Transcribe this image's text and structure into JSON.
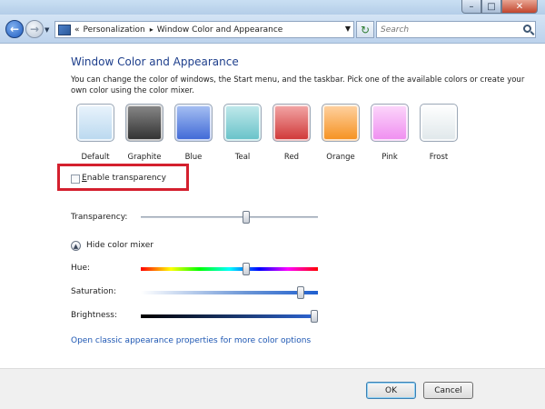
{
  "window": {
    "controls": {
      "minimize": "–",
      "maximize": "□",
      "close": "✕"
    }
  },
  "nav": {
    "back_glyph": "←",
    "forward_glyph": "→",
    "breadcrumb": [
      "«",
      "Personalization",
      "Window Color and Appearance"
    ],
    "breadcrumb_separator": "▸",
    "refresh_glyph": "↻",
    "search_placeholder": "Search"
  },
  "content": {
    "title": "Window Color and Appearance",
    "description": "You can change the color of windows, the Start menu, and the taskbar. Pick one of the available colors or create your own color using the color mixer.",
    "swatches": [
      {
        "label": "Default",
        "color_top": "#eaf4fc",
        "color_bottom": "#b9d8ef"
      },
      {
        "label": "Graphite",
        "color_top": "#8a8a8a",
        "color_bottom": "#2f2f2f"
      },
      {
        "label": "Blue",
        "color_top": "#a9c2f3",
        "color_bottom": "#3d67d6"
      },
      {
        "label": "Teal",
        "color_top": "#c3eaec",
        "color_bottom": "#66c2c8"
      },
      {
        "label": "Red",
        "color_top": "#f3a9a9",
        "color_bottom": "#cf3535"
      },
      {
        "label": "Orange",
        "color_top": "#ffd3a4",
        "color_bottom": "#f5901d"
      },
      {
        "label": "Pink",
        "color_top": "#fcd8fb",
        "color_bottom": "#ef8df0"
      },
      {
        "label": "Frost",
        "color_top": "#ffffff",
        "color_bottom": "#dfe7ea"
      }
    ],
    "transparency_checkbox": {
      "label_underlined": "E",
      "label_rest": "nable transparency",
      "checked": false
    },
    "transparency_label": "Transparency:",
    "mixer_toggle_glyph": "▲",
    "mixer_label": "Hide color mixer",
    "sliders": [
      {
        "key": "hue",
        "label": "Hue:",
        "value": 0.6
      },
      {
        "key": "sat",
        "label": "Saturation:",
        "value": 0.92
      },
      {
        "key": "bri",
        "label": "Brightness:",
        "value": 1.0
      }
    ],
    "transparency_value": 0.6,
    "link": "Open classic appearance properties for more color options"
  },
  "footer": {
    "ok_label": "OK",
    "cancel_label": "Cancel"
  }
}
